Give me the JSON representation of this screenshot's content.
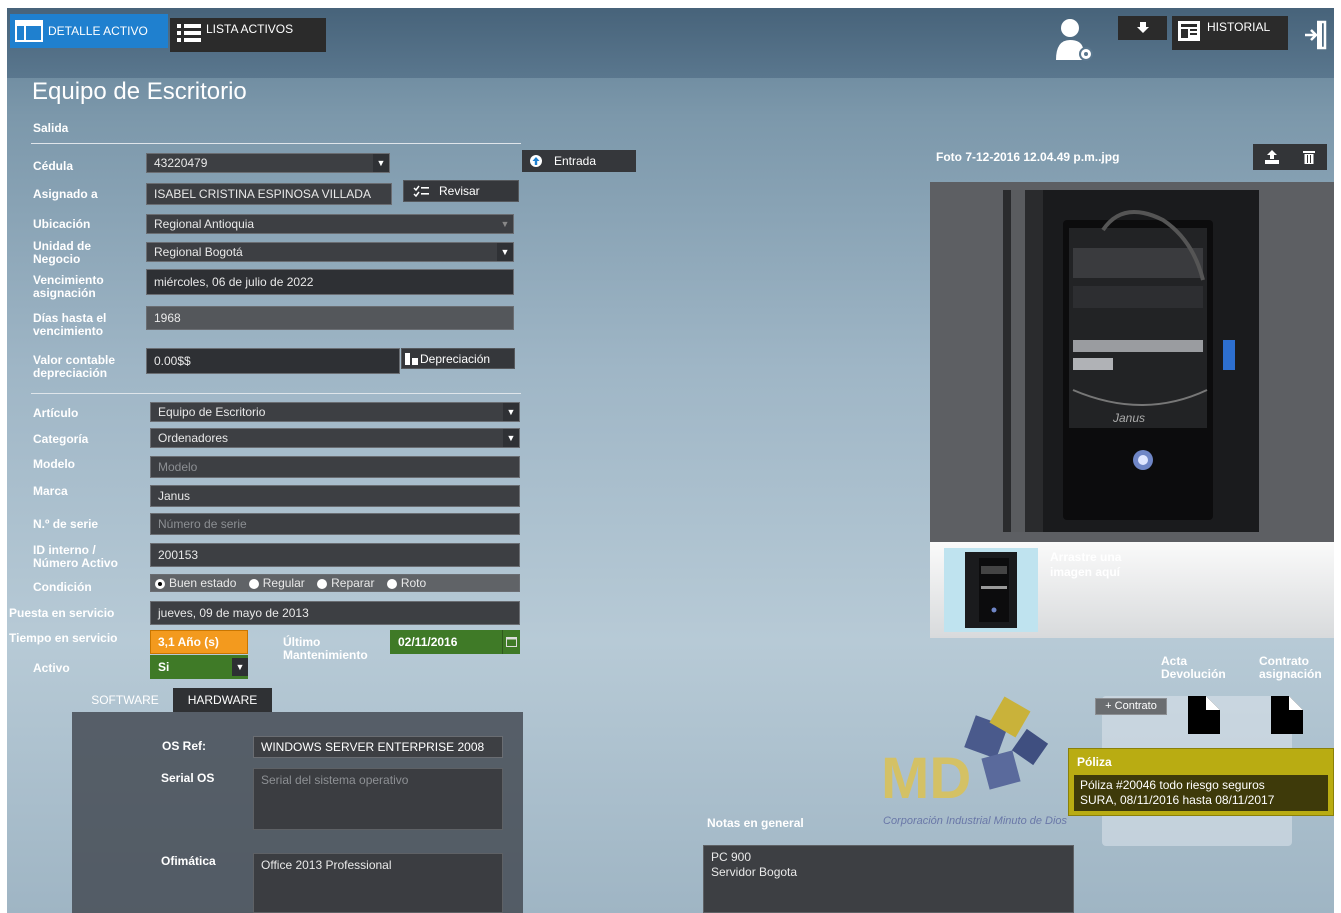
{
  "nav": {
    "detail_label": "DETALLE ACTIVO",
    "list_label": "LISTA ACTIVOS",
    "history_label": "HISTORIAL"
  },
  "page_title": "Equipo de Escritorio",
  "section_exit": "Salida",
  "form": {
    "cedula_label": "Cédula",
    "cedula_value": "43220479",
    "assigned_label": "Asignado a",
    "assigned_value": "ISABEL CRISTINA ESPINOSA VILLADA",
    "review_label": "Revisar",
    "entry_label": "Entrada",
    "location_label": "Ubicación",
    "location_value": "Regional Antioquia",
    "business_unit_label": "Unidad de Negocio",
    "business_unit_value": "Regional Bogotá",
    "expiry_label": "Vencimiento asignación",
    "expiry_value": "miércoles, 06 de julio de 2022",
    "days_label": "Días hasta el vencimiento",
    "days_value": "1968",
    "book_value_label": "Valor contable depreciación",
    "book_value_value": "0.00$$",
    "depreciation_label": "Depreciación",
    "article_label": "Artículo",
    "article_value": "Equipo de Escritorio",
    "category_label": "Categoría",
    "category_value": "Ordenadores",
    "model_label": "Modelo",
    "model_placeholder": "Modelo",
    "brand_label": "Marca",
    "brand_value": "Janus",
    "serial_label": "N.º de serie",
    "serial_placeholder": "Número de serie",
    "internal_id_label": "ID interno / Número Activo",
    "internal_id_value": "200153",
    "condition_label": "Condición",
    "condition_options": [
      "Buen estado",
      "Regular",
      "Reparar",
      "Roto"
    ],
    "condition_selected": "Buen estado",
    "service_start_label": "Puesta en servicio",
    "service_start_value": "jueves, 09 de mayo de 2013",
    "time_in_service_label": "Tiempo en servicio",
    "time_in_service_value": "3,1 Año (s)",
    "last_maintenance_label": "Último Mantenimiento",
    "last_maintenance_value": "02/11/2016",
    "active_label": "Activo",
    "active_value": "Si"
  },
  "tabs": [
    "SOFTWARE",
    "HARDWARE"
  ],
  "software": {
    "os_ref_label": "OS Ref:",
    "os_ref_value": "WINDOWS SERVER ENTERPRISE 2008",
    "serial_os_label": "Serial OS",
    "serial_os_placeholder": "Serial del sistema operativo",
    "office_label": "Ofimática",
    "office_value": "Office 2013 Professional"
  },
  "photo": {
    "filename": "Foto 7-12-2016 12.04.49 p.m..jpg",
    "drop_hint": "Arrastre una imagen aquí",
    "case_brand": "Janus"
  },
  "documents": {
    "return_act_label": "Acta Devolución",
    "assignment_contract_label": "Contrato asignación",
    "add_contract_label": "+ Contrato"
  },
  "policy": {
    "title": "Póliza",
    "line1": "Póliza #20046 todo riesgo seguros",
    "line2": "SURA, 08/11/2016  hasta  08/11/2017"
  },
  "notes": {
    "label": "Notas en general",
    "line1": "PC 900",
    "line2": "Servidor Bogota"
  },
  "logo": {
    "initials": "MD",
    "text": "Corporación Industrial Minuto de Dios"
  },
  "colors": {
    "accent_blue": "#1f80cf",
    "orange": "#f39a1e",
    "green": "#3f7a27",
    "policy_yellow": "#b9ac12"
  }
}
